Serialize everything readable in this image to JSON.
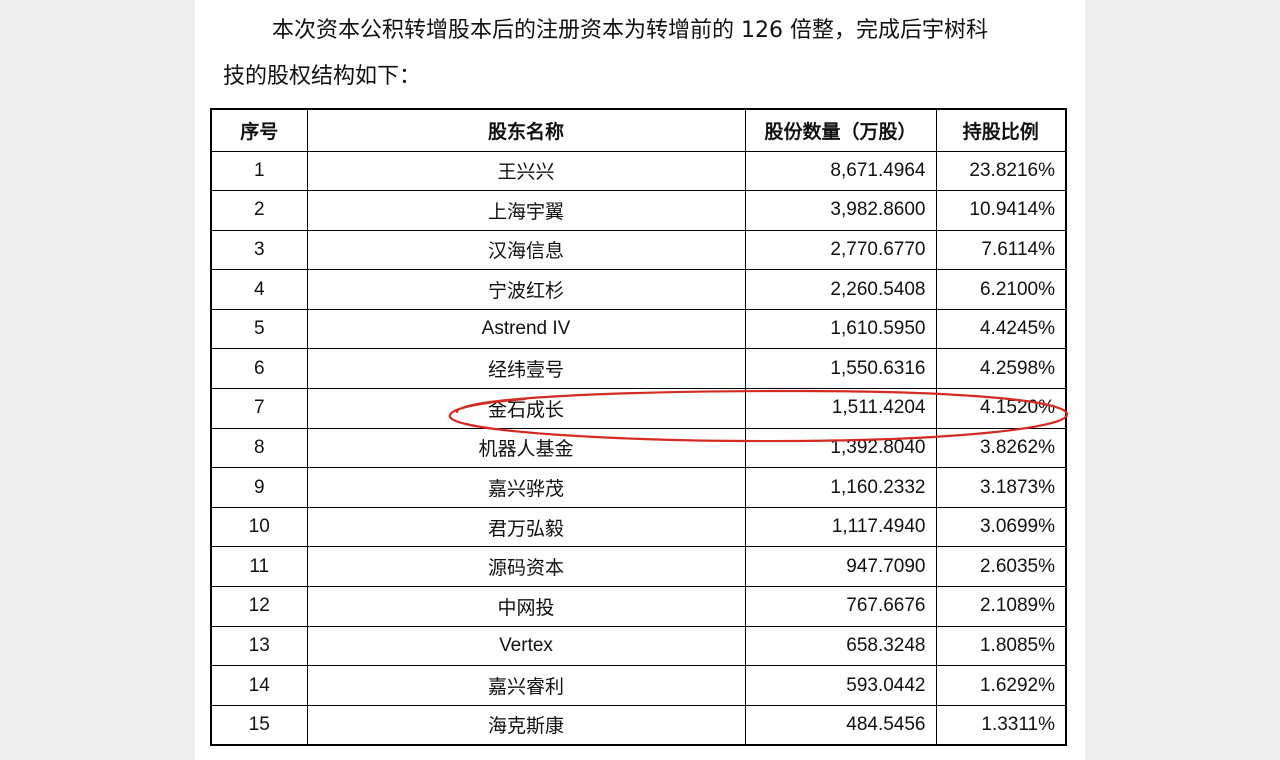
{
  "document": {
    "paragraph_line1": "本次资本公积转增股本后的注册资本为转增前的 126 倍整，完成后宇树科",
    "paragraph_line2": "技的股权结构如下："
  },
  "table": {
    "headers": [
      "序号",
      "股东名称",
      "股份数量（万股）",
      "持股比例"
    ],
    "rows": [
      {
        "no": "1",
        "name": "王兴兴",
        "shares": "8,671.4964",
        "ratio": "23.8216%"
      },
      {
        "no": "2",
        "name": "上海宇翼",
        "shares": "3,982.8600",
        "ratio": "10.9414%"
      },
      {
        "no": "3",
        "name": "汉海信息",
        "shares": "2,770.6770",
        "ratio": "7.6114%"
      },
      {
        "no": "4",
        "name": "宁波红杉",
        "shares": "2,260.5408",
        "ratio": "6.2100%"
      },
      {
        "no": "5",
        "name": "Astrend IV",
        "shares": "1,610.5950",
        "ratio": "4.4245%"
      },
      {
        "no": "6",
        "name": "经纬壹号",
        "shares": "1,550.6316",
        "ratio": "4.2598%"
      },
      {
        "no": "7",
        "name": "金石成长",
        "shares": "1,511.4204",
        "ratio": "4.1520%"
      },
      {
        "no": "8",
        "name": "机器人基金",
        "shares": "1,392.8040",
        "ratio": "3.8262%"
      },
      {
        "no": "9",
        "name": "嘉兴骅茂",
        "shares": "1,160.2332",
        "ratio": "3.1873%"
      },
      {
        "no": "10",
        "name": "君万弘毅",
        "shares": "1,117.4940",
        "ratio": "3.0699%"
      },
      {
        "no": "11",
        "name": "源码资本",
        "shares": "947.7090",
        "ratio": "2.6035%"
      },
      {
        "no": "12",
        "name": "中网投",
        "shares": "767.6676",
        "ratio": "2.1089%"
      },
      {
        "no": "13",
        "name": "Vertex",
        "shares": "658.3248",
        "ratio": "1.8085%"
      },
      {
        "no": "14",
        "name": "嘉兴睿利",
        "shares": "593.0442",
        "ratio": "1.6292%"
      },
      {
        "no": "15",
        "name": "海克斯康",
        "shares": "484.5456",
        "ratio": "1.3311%"
      }
    ]
  },
  "annotation": {
    "highlighted_row_no": "7",
    "ink_color": "#d42a22"
  }
}
